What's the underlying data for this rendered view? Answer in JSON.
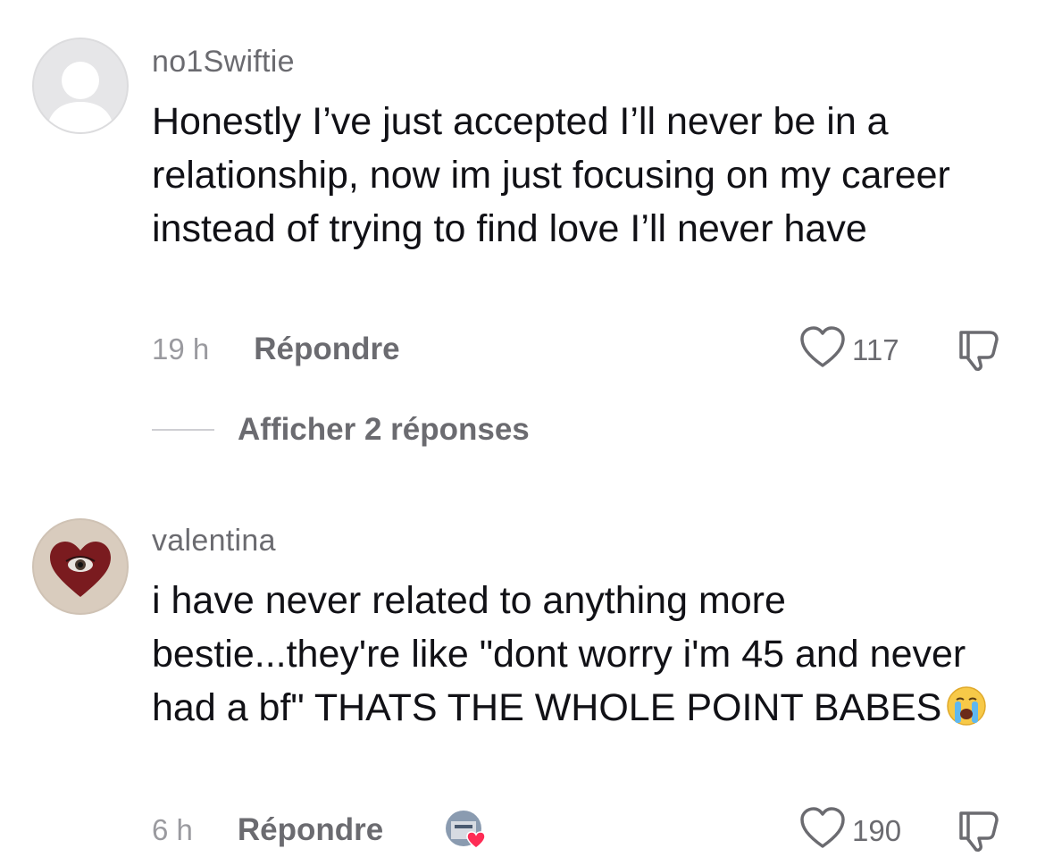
{
  "comments": [
    {
      "avatar_icon": "default-user-icon",
      "username": "no1Swiftie",
      "text": "Honestly I’ve just accepted I’ll never be in a relationship, now im just focusing on my career instead of trying to find love I’ll never have",
      "timestamp": "19 h",
      "reply_label": "Répondre",
      "like_count": "117",
      "view_replies_label": "Afficher 2 réponses"
    },
    {
      "avatar_icon": "heart-eye-avatar",
      "username": "valentina",
      "text": "i have never related to anything more bestie...they're like \"dont worry i'm 45 and never had a bf\" THATS THE WHOLE POINT BABES",
      "emoji": "crying-face-emoji",
      "timestamp": "6 h",
      "reply_label": "Répondre",
      "liked_by_creator_icon": "creator-liked-avatar-icon",
      "like_count": "190"
    }
  ],
  "colors": {
    "primary_text": "#111116",
    "secondary_text": "#6b6b70",
    "timestamp": "#9a9a9f",
    "creator_heart": "#fe2c55"
  }
}
